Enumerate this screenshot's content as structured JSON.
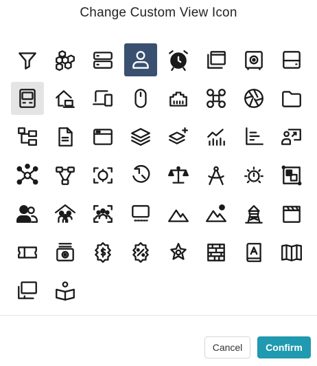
{
  "dialog": {
    "title": "Change Custom View Icon",
    "cancel_label": "Cancel",
    "confirm_label": "Confirm"
  },
  "colors": {
    "selected_bg": "#3a5070",
    "hover_bg": "#e4e4e4",
    "confirm_bg": "#1f9ab0",
    "icon": "#1a1a1a"
  },
  "selected_icon": "user-icon",
  "hovered_icon": "computer-tower-icon",
  "icons": [
    "filter-icon",
    "cubes-icon",
    "server-icon",
    "user-icon",
    "alarm-clock-icon",
    "windows-stack-icon",
    "safe-icon",
    "hard-drive-icon",
    "computer-tower-icon",
    "home-network-icon",
    "devices-icon",
    "mouse-icon",
    "ethernet-port-icon",
    "drone-icon",
    "camera-aperture-icon",
    "folder-icon",
    "sitemap-icon",
    "document-icon",
    "browser-window-icon",
    "layers-icon",
    "add-layer-icon",
    "chart-trend-icon",
    "bar-chart-icon",
    "presentation-user-icon",
    "network-hub-icon",
    "network-nodes-icon",
    "focus-rotate-icon",
    "rotate-left-icon",
    "scales-icon",
    "compass-icon",
    "brightness-icon",
    "resize-corners-icon",
    "users-icon",
    "family-home-icon",
    "group-scan-icon",
    "monitor-keys-icon",
    "mountains-icon",
    "mountain-sun-icon",
    "watchtower-icon",
    "clapperboard-icon",
    "ticket-icon",
    "cash-register-icon",
    "dollar-badge-icon",
    "percent-badge-icon",
    "sheriff-star-icon",
    "brick-wall-icon",
    "address-book-icon",
    "open-book-icon",
    "library-books-icon",
    "reading-person-icon"
  ]
}
